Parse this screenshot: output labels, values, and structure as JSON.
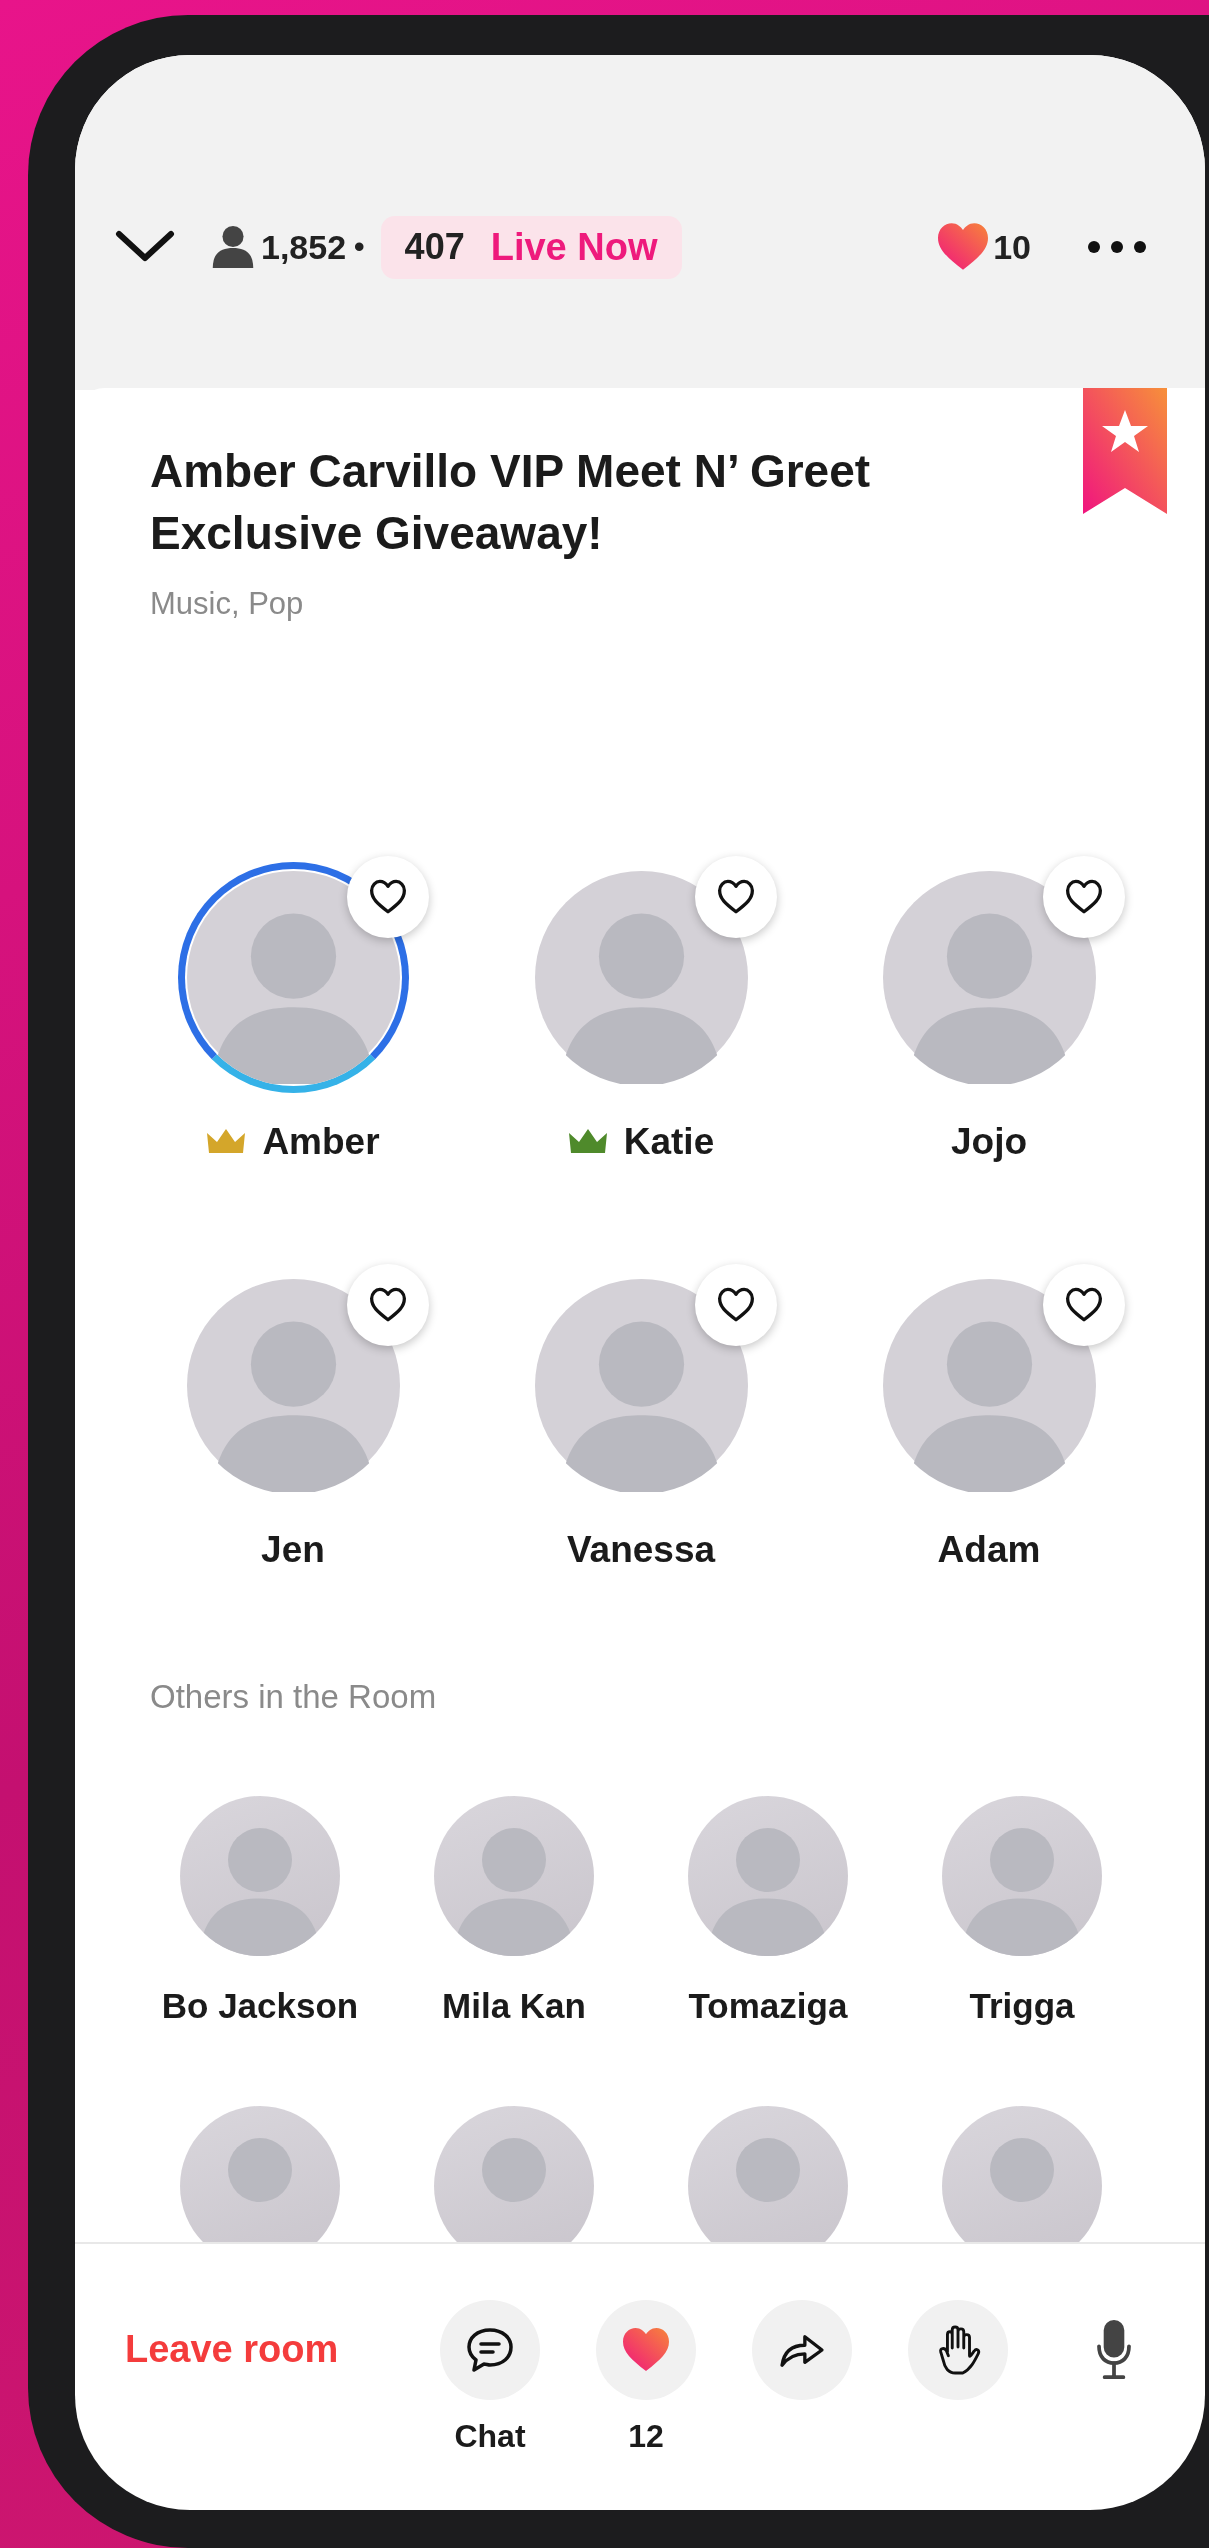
{
  "header": {
    "viewers": "1,852",
    "separator": "•",
    "live_count": "407",
    "live_label": "Live Now",
    "likes": "10"
  },
  "event": {
    "title": "Amber Carvillo VIP Meet N’ Greet Exclusive Giveaway!",
    "categories": "Music, Pop",
    "bookmarked": true
  },
  "speakers": [
    {
      "name": "Amber",
      "speaking": true,
      "favorited": false,
      "crown": true,
      "color": "#d4a62a"
    },
    {
      "name": "Katie",
      "speaking": false,
      "favorited": false,
      "crown": true,
      "color": "#4f8a2b"
    },
    {
      "name": "Jojo",
      "speaking": false,
      "favorited": false,
      "crown": false
    },
    {
      "name": "Jen",
      "speaking": false,
      "favorited": false,
      "crown": false
    },
    {
      "name": "Vanessa",
      "speaking": false,
      "favorited": false,
      "crown": false
    },
    {
      "name": "Adam",
      "speaking": false,
      "favorited": false,
      "crown": false
    }
  ],
  "others_heading": "Others in the Room",
  "others": [
    {
      "name": "Bo Jackson"
    },
    {
      "name": "Mila Kan"
    },
    {
      "name": "Tomaziga"
    },
    {
      "name": "Trigga"
    }
  ],
  "toolbar": {
    "leave_label": "Leave room",
    "actions": [
      {
        "kind": "chat",
        "label": "Chat"
      },
      {
        "kind": "like",
        "label": "12"
      },
      {
        "kind": "share"
      },
      {
        "kind": "raise_hand"
      },
      {
        "kind": "mic"
      }
    ]
  }
}
